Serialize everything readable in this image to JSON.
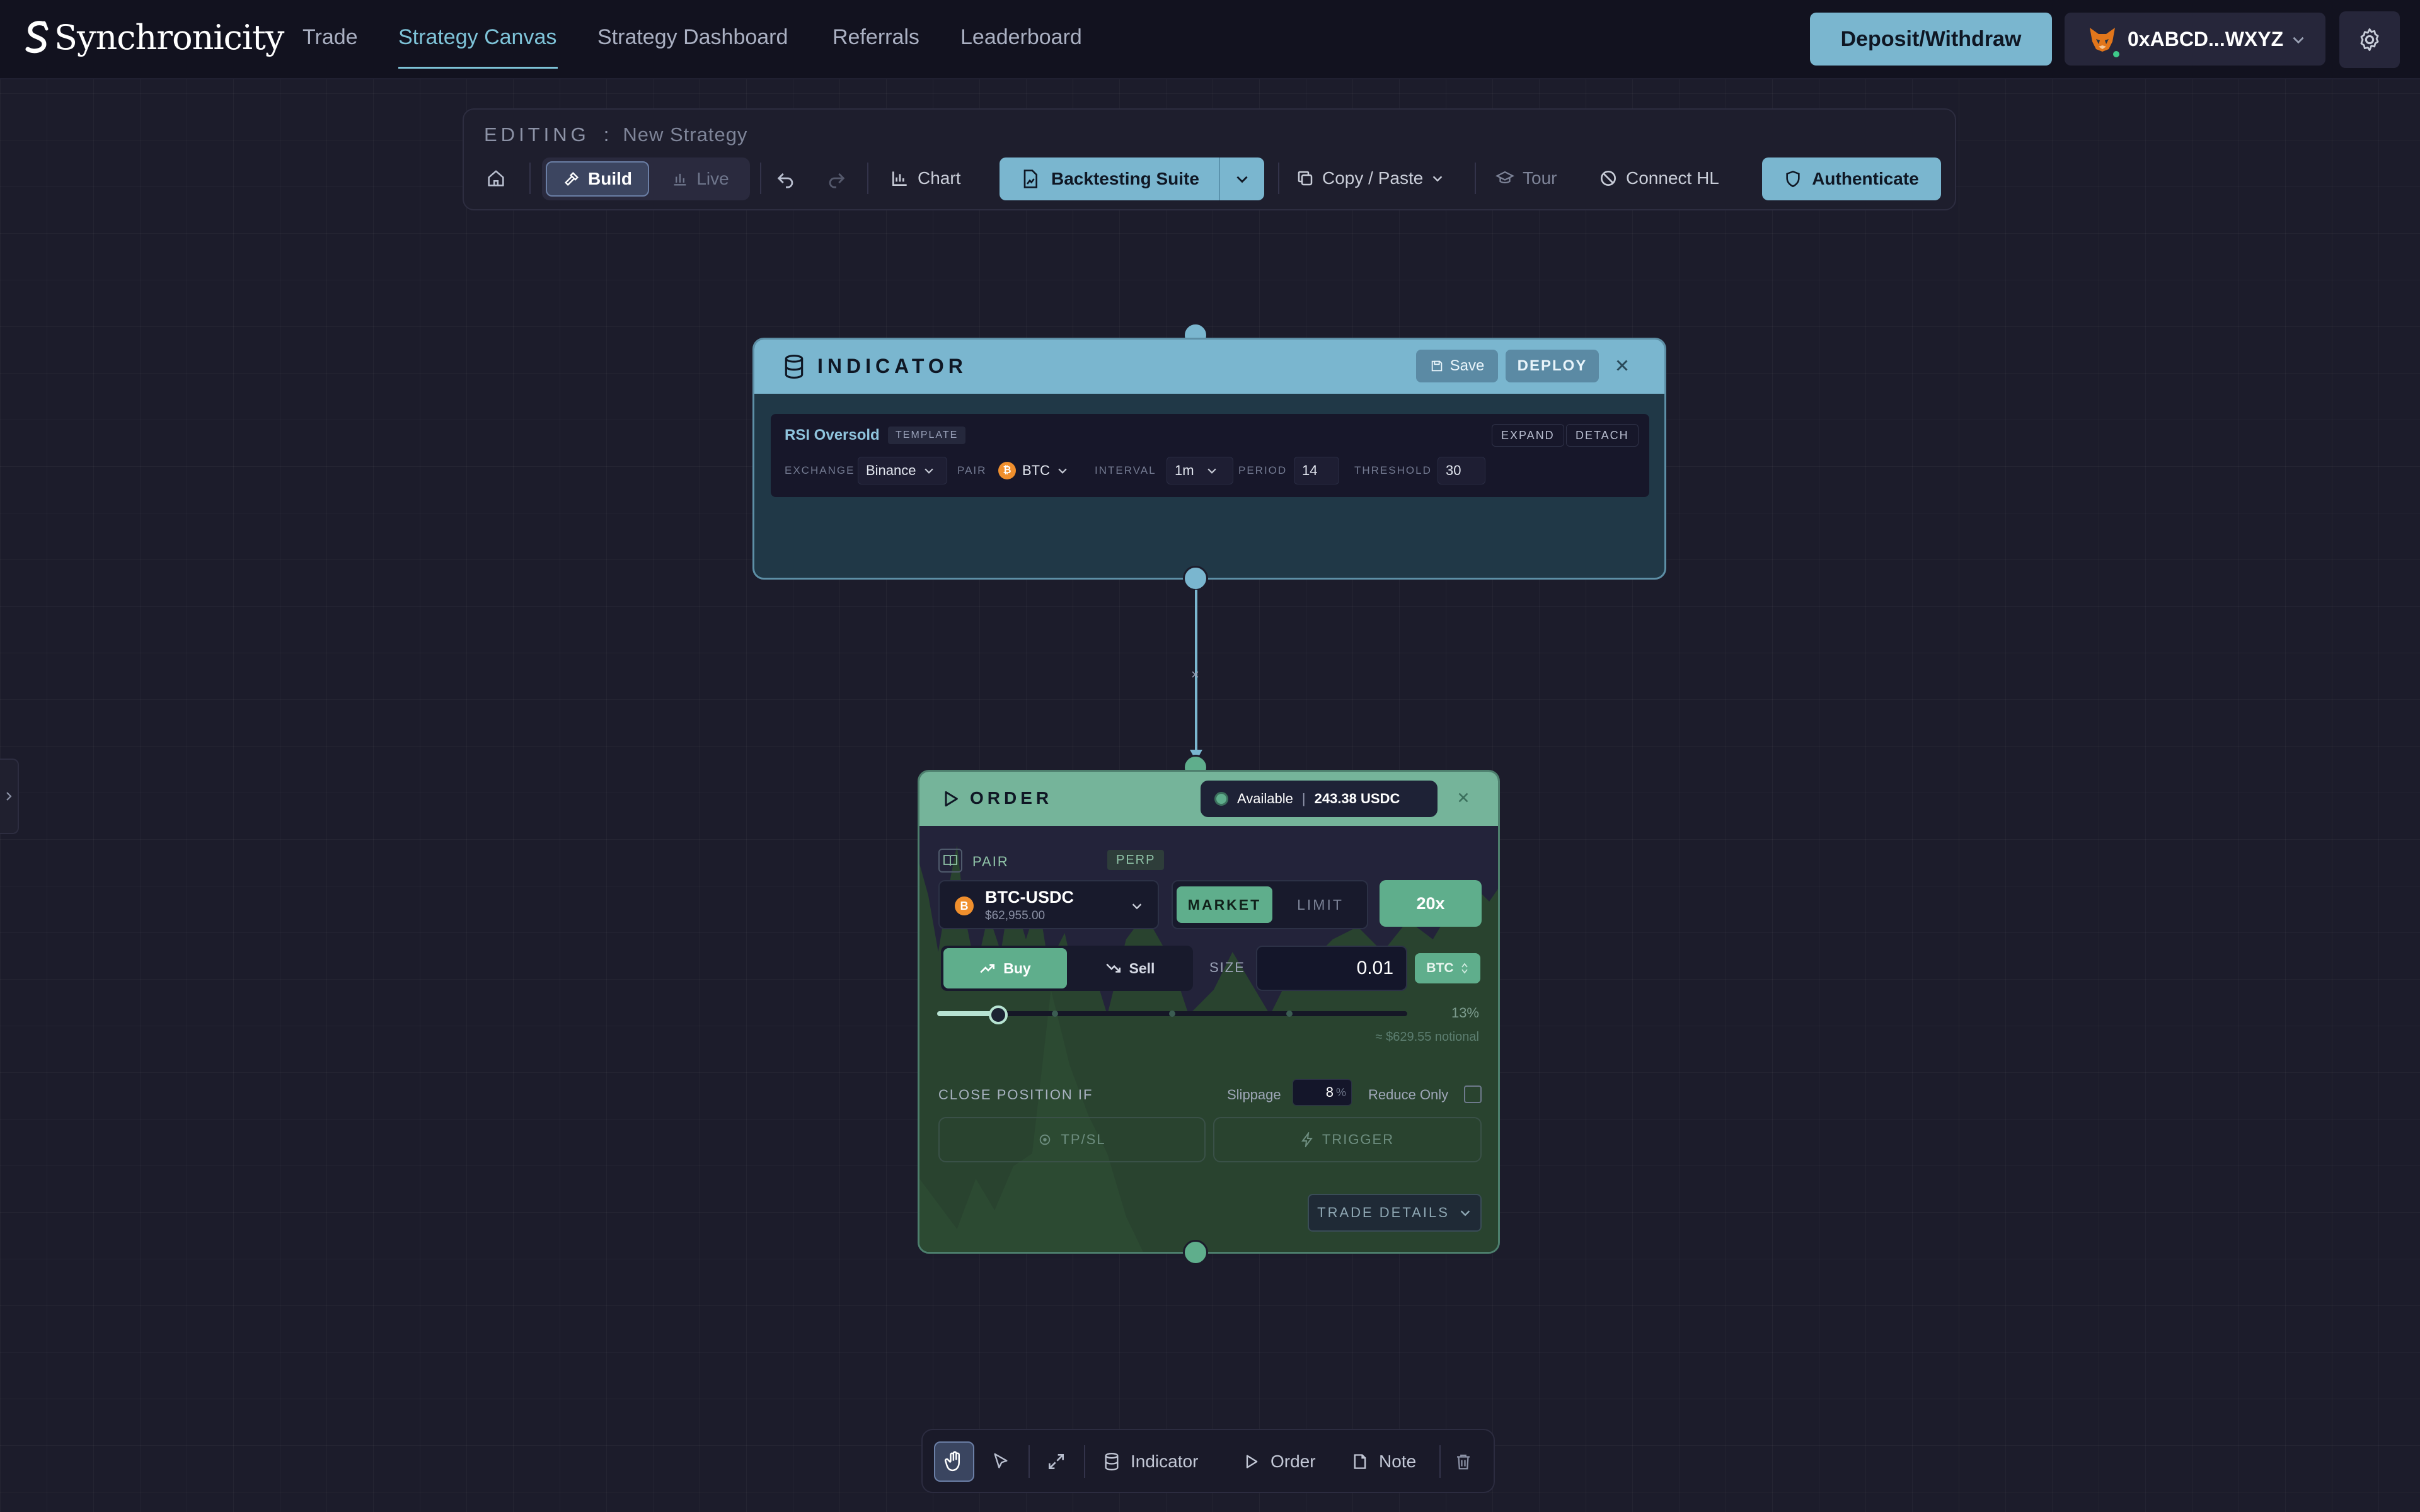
{
  "app": {
    "name": "Synchronicity",
    "nav": [
      {
        "label": "Trade"
      },
      {
        "label": "Strategy Canvas",
        "active": true
      },
      {
        "label": "Strategy Dashboard"
      },
      {
        "label": "Referrals"
      },
      {
        "label": "Leaderboard"
      }
    ],
    "deposit_label": "Deposit/Withdraw",
    "wallet_address": "0xABCD...WXYZ",
    "wallet_icon": "fox-wallet-icon",
    "settings_icon": "gear-icon"
  },
  "toolbar": {
    "editing_label": "EDITING",
    "separator": ":",
    "strategy_name": "New Strategy",
    "home_icon": "home-icon",
    "mode": {
      "build": "Build",
      "live": "Live",
      "selected": "Build"
    },
    "undo_icon": "undo-icon",
    "redo_icon": "redo-icon",
    "chart_label": "Chart",
    "backtest_label": "Backtesting Suite",
    "copy_paste_label": "Copy / Paste",
    "tour_label": "Tour",
    "connect_label": "Connect HL",
    "auth_label": "Authenticate"
  },
  "indicator_node": {
    "title": "INDICATOR",
    "save_label": "Save",
    "deploy_label": "DEPLOY",
    "card": {
      "name": "RSI Oversold",
      "tag": "TEMPLATE",
      "expand_label": "EXPAND",
      "detach_label": "DETACH",
      "exchange_label": "EXCHANGE",
      "exchange": "Binance",
      "pair_label": "PAIR",
      "pair": "BTC",
      "interval_label": "INTERVAL",
      "interval": "1m",
      "period_label": "PERIOD",
      "period": "14",
      "threshold_label": "THRESHOLD",
      "threshold": "30"
    }
  },
  "edge": {
    "remove_label": "×"
  },
  "order_node": {
    "title": "ORDER",
    "available_label": "Available",
    "available_sep": "|",
    "available_amount": "243.38 USDC",
    "pair_label": "PAIR",
    "market_type": "PERP",
    "coin_symbol": "B",
    "pair": "BTC-USDC",
    "pair_price": "$62,955.00",
    "order_types": {
      "market": "MARKET",
      "limit": "LIMIT",
      "selected": "MARKET"
    },
    "leverage": "20x",
    "side": {
      "buy": "Buy",
      "sell": "Sell",
      "selected": "Buy"
    },
    "size_label": "SIZE",
    "size_value": "0.01",
    "size_unit": "BTC",
    "size_percent": 13,
    "size_percent_label": "13%",
    "notional_label": "≈ $629.55 notional",
    "close_label": "CLOSE POSITION IF",
    "slippage_label": "Slippage",
    "slippage_value": "8",
    "slippage_unit": "%",
    "reduce_only_label": "Reduce Only",
    "reduce_only": false,
    "tpsl_label": "TP/SL",
    "trigger_label": "TRIGGER",
    "details_label": "TRADE DETAILS"
  },
  "bottom_toolbar": {
    "indicator_label": "Indicator",
    "order_label": "Order",
    "note_label": "Note"
  },
  "colors": {
    "background": "#1c1c2b",
    "accent_blue": "#7ab6cf",
    "accent_green": "#5fae8c",
    "bitcoin": "#f08f2d"
  }
}
